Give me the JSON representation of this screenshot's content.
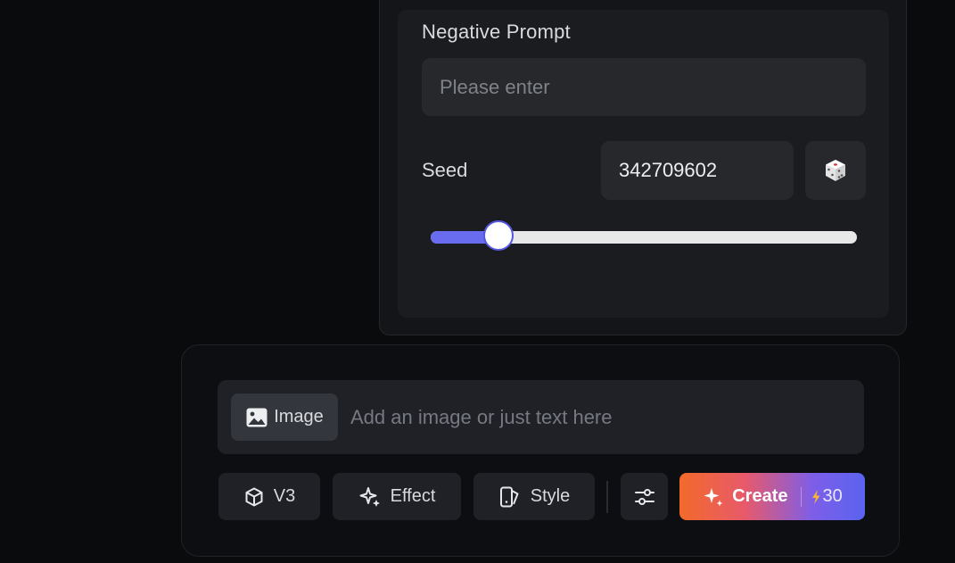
{
  "settings": {
    "negative_prompt": {
      "label": "Negative Prompt",
      "placeholder": "Please enter",
      "value": ""
    },
    "seed": {
      "label": "Seed",
      "value": "342709602",
      "randomize_icon": "dice-icon"
    },
    "slider": {
      "fraction": 0.16,
      "fill_color": "#6a6cf0"
    }
  },
  "composer": {
    "image_button": {
      "label": "Image",
      "icon": "image-icon"
    },
    "prompt": {
      "placeholder": "Add an image or just text here",
      "value": ""
    },
    "tools": {
      "model": {
        "label": "V3",
        "icon": "cube-icon"
      },
      "effect": {
        "label": "Effect",
        "icon": "sparkle-icon"
      },
      "style": {
        "label": "Style",
        "icon": "style-icon"
      },
      "settings": {
        "icon": "sliders-icon"
      }
    },
    "create": {
      "label": "Create",
      "icon": "sparkle-icon",
      "cost_icon": "lightning-icon",
      "cost": "30",
      "gradient": [
        "#f26a2a",
        "#e85a6a",
        "#7d5ee8",
        "#5a63f0"
      ]
    }
  }
}
